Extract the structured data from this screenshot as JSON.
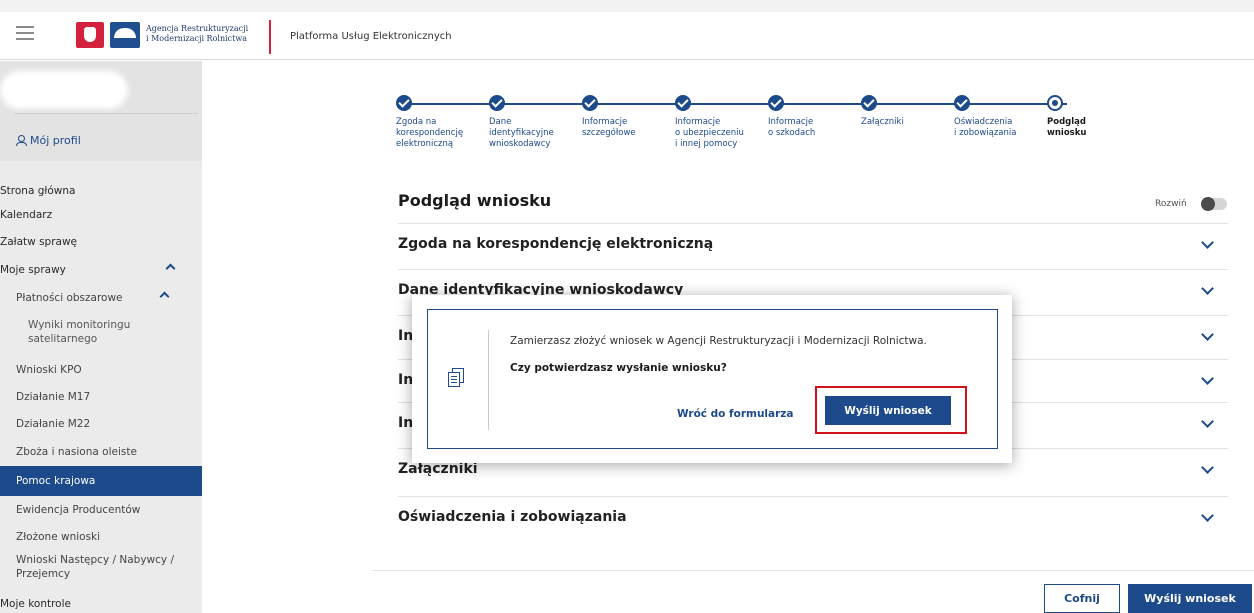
{
  "header": {
    "logo_line1": "Agencja Restrukturyzacji",
    "logo_line2": "i Modernizacji Rolnictwa",
    "platform_title": "Platforma Usług Elektronicznych"
  },
  "sidebar": {
    "profile_label": "Mój profil",
    "items": [
      {
        "label": "Strona główna"
      },
      {
        "label": "Kalendarz"
      },
      {
        "label": "Załatw sprawę"
      },
      {
        "label": "Moje sprawy"
      },
      {
        "label": "Płatności obszarowe"
      },
      {
        "label": "Wyniki monitoringu satelitarnego"
      },
      {
        "label": "Wnioski KPO"
      },
      {
        "label": "Działanie M17"
      },
      {
        "label": "Działanie M22"
      },
      {
        "label": "Zboża i nasiona oleiste"
      },
      {
        "label": "Pomoc krajowa"
      },
      {
        "label": "Ewidencja Producentów"
      },
      {
        "label": "Złożone wnioski"
      },
      {
        "label": "Wnioski Następcy / Nabywcy / Przejemcy"
      },
      {
        "label": "Moje kontrole"
      }
    ]
  },
  "stepper": {
    "steps": [
      {
        "label": "Zgoda na\nkorespondencję\nelektroniczną",
        "state": "done"
      },
      {
        "label": "Dane\nidentyfikacyjne\nwnioskodawcy",
        "state": "done"
      },
      {
        "label": "Informacje\nszczegółowe",
        "state": "done"
      },
      {
        "label": "Informacje\no ubezpieczeniu\ni innej pomocy",
        "state": "done"
      },
      {
        "label": "Informacje\no szkodach",
        "state": "done"
      },
      {
        "label": "Załączniki",
        "state": "done"
      },
      {
        "label": "Oświadczenia\ni zobowiązania",
        "state": "done"
      },
      {
        "label": "Podgląd\nwniosku",
        "state": "current"
      }
    ]
  },
  "main": {
    "section_title": "Podgląd wniosku",
    "expand_label": "Rozwiń",
    "accordion": [
      {
        "label": "Zgoda na korespondencję elektroniczną"
      },
      {
        "label": "Dane identyfikacyjne wnioskodawcy"
      },
      {
        "label": "In"
      },
      {
        "label": "In"
      },
      {
        "label": "In"
      },
      {
        "label": "Załączniki"
      },
      {
        "label": "Oświadczenia i zobowiązania"
      }
    ],
    "back_button": "Cofnij",
    "send_button": "Wyślij wniosek"
  },
  "modal": {
    "message": "Zamierzasz złożyć wniosek w Agencji Restrukturyzacji i Modernizacji Rolnictwa.",
    "question": "Czy potwierdzasz wysłanie wniosku?",
    "back_link": "Wróć do formularza",
    "send_button": "Wyślij wniosek"
  },
  "colors": {
    "accent": "#1c4a8b",
    "highlight": "#d0111b",
    "brand_red": "#d4213d"
  }
}
